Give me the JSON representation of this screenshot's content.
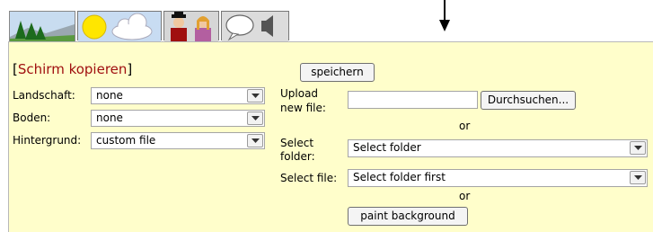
{
  "tabs": [
    {
      "icon": "landscape-icon"
    },
    {
      "icon": "weather-icon"
    },
    {
      "icon": "characters-icon"
    },
    {
      "icon": "speech-sound-icon"
    }
  ],
  "panel": {
    "title_open": "[",
    "title": "Schirm kopieren",
    "title_close": "]",
    "save_label": "speichern",
    "left": {
      "landscape_label": "Landschaft:",
      "landscape_value": "none",
      "ground_label": "Boden:",
      "ground_value": "none",
      "background_label": "Hintergrund:",
      "background_value": "custom file"
    },
    "right": {
      "upload_label_line1": "Upload",
      "upload_label_line2": "new file:",
      "browse_label": "Durchsuchen...",
      "or1": "or",
      "folder_label_line1": "Select",
      "folder_label_line2": "folder:",
      "folder_value": "Select folder",
      "file_label": "Select file:",
      "file_value": "Select folder first",
      "or2": "or",
      "paint_label": "paint background"
    }
  },
  "colors": {
    "panel_bg": "#fffecb",
    "title": "#a01010"
  }
}
